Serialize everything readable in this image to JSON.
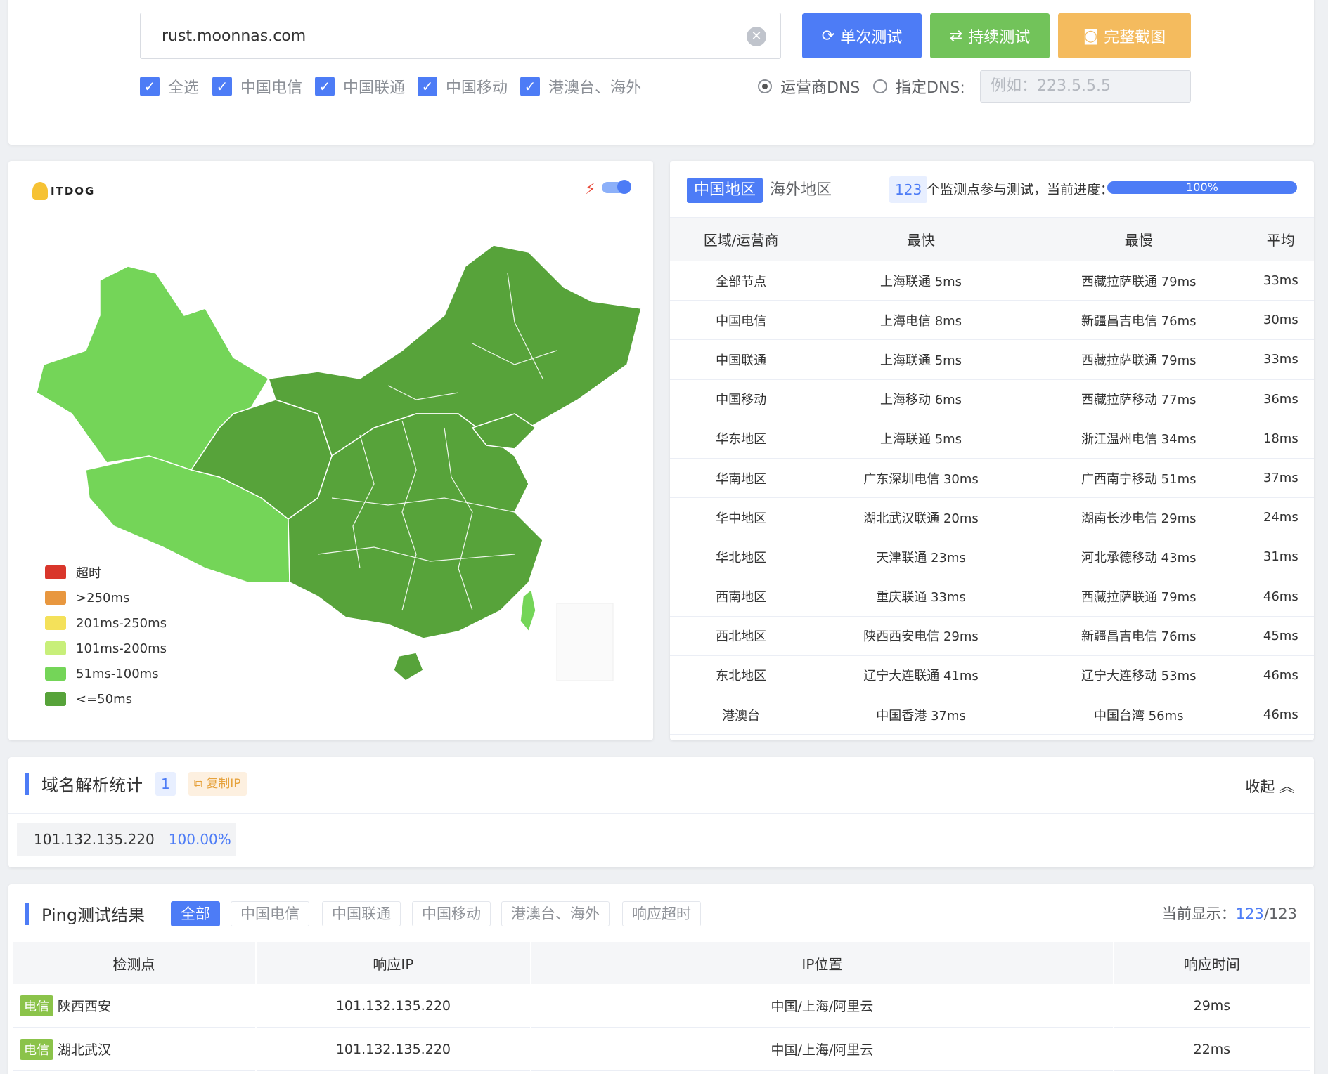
{
  "search": {
    "url": "rust.moonnas.com"
  },
  "buttons": {
    "single": "单次测试",
    "continuous": "持续测试",
    "screenshot": "完整截图"
  },
  "filters": [
    "全选",
    "中国电信",
    "中国联通",
    "中国移动",
    "港澳台、海外"
  ],
  "dns": {
    "isp_label": "运营商DNS",
    "custom_label": "指定DNS:",
    "placeholder": "例如：223.5.5.5"
  },
  "map": {
    "logo": "ITDOG",
    "legend": [
      {
        "label": "超时",
        "color": "#d9362b"
      },
      {
        "label": ">250ms",
        "color": "#e8973f"
      },
      {
        "label": "201ms-250ms",
        "color": "#f4e15a"
      },
      {
        "label": "101ms-200ms",
        "color": "#c8ef7a"
      },
      {
        "label": "51ms-100ms",
        "color": "#74d558"
      },
      {
        "label": "<=50ms",
        "color": "#57a33a"
      }
    ]
  },
  "stats": {
    "tab_china": "中国地区",
    "tab_overseas": "海外地区",
    "node_count": "123",
    "node_text": "个监测点参与测试，当前进度：",
    "progress": "100%",
    "headers": [
      "区域/运营商",
      "最快",
      "最慢",
      "平均"
    ],
    "rows": [
      [
        "全部节点",
        "上海联通 5ms",
        "西藏拉萨联通 79ms",
        "33ms"
      ],
      [
        "中国电信",
        "上海电信 8ms",
        "新疆昌吉电信 76ms",
        "30ms"
      ],
      [
        "中国联通",
        "上海联通 5ms",
        "西藏拉萨联通 79ms",
        "33ms"
      ],
      [
        "中国移动",
        "上海移动 6ms",
        "西藏拉萨移动 77ms",
        "36ms"
      ],
      [
        "华东地区",
        "上海联通 5ms",
        "浙江温州电信 34ms",
        "18ms"
      ],
      [
        "华南地区",
        "广东深圳电信 30ms",
        "广西南宁移动 51ms",
        "37ms"
      ],
      [
        "华中地区",
        "湖北武汉联通 20ms",
        "湖南长沙电信 29ms",
        "24ms"
      ],
      [
        "华北地区",
        "天津联通 23ms",
        "河北承德移动 43ms",
        "31ms"
      ],
      [
        "西南地区",
        "重庆联通 33ms",
        "西藏拉萨联通 79ms",
        "46ms"
      ],
      [
        "西北地区",
        "陕西西安电信 29ms",
        "新疆昌吉电信 76ms",
        "45ms"
      ],
      [
        "东北地区",
        "辽宁大连联通 41ms",
        "辽宁大连移动 53ms",
        "46ms"
      ],
      [
        "港澳台",
        "中国香港 37ms",
        "中国台湾 56ms",
        "46ms"
      ]
    ]
  },
  "dns_stats": {
    "title": "域名解析统计",
    "count": "1",
    "copy_label": "复制IP",
    "collapse_label": "收起",
    "ip": "101.132.135.220",
    "percent": "100.00%"
  },
  "ping": {
    "title": "Ping测试结果",
    "filters": [
      "全部",
      "中国电信",
      "中国联通",
      "中国移动",
      "港澳台、海外",
      "响应超时"
    ],
    "showing_label": "当前显示：",
    "showing_current": "123",
    "showing_total": "/123",
    "headers": [
      "检测点",
      "响应IP",
      "IP位置",
      "响应时间"
    ],
    "rows": [
      {
        "isp": "电信",
        "location": "陕西西安",
        "ip": "101.132.135.220",
        "ip_location": "中国/上海/阿里云",
        "time": "29ms"
      },
      {
        "isp": "电信",
        "location": "湖北武汉",
        "ip": "101.132.135.220",
        "ip_location": "中国/上海/阿里云",
        "time": "22ms"
      }
    ]
  }
}
